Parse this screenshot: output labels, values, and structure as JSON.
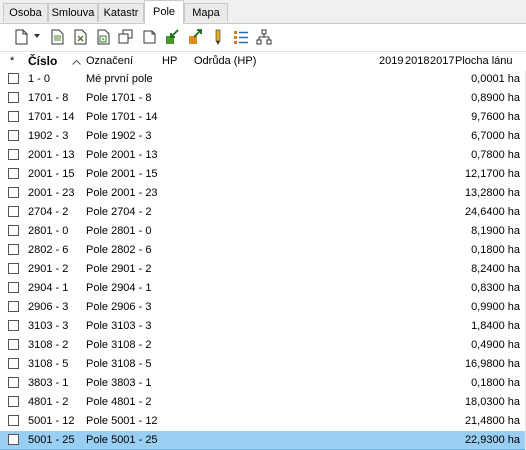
{
  "tabs": [
    {
      "label": "Osoba"
    },
    {
      "label": "Smlouva"
    },
    {
      "label": "Katastr"
    },
    {
      "label": "Pole",
      "active": true
    },
    {
      "label": "Mapa"
    }
  ],
  "toolbar": {
    "icons": [
      "new-document-icon",
      "document-icon",
      "delete-document-icon",
      "copy-document-icon",
      "copy-windows-icon",
      "window-icon",
      "import-icon",
      "export-icon",
      "pen-icon",
      "list-icon",
      "tree-icon"
    ]
  },
  "header": {
    "star": "*",
    "cislo": "Číslo",
    "oznaceni": "Označení",
    "hp": "HP",
    "odruda": "Odrůda (HP)",
    "y2019": "2019",
    "y2018": "2018",
    "y2017": "2017",
    "plocha": "Plocha lánu"
  },
  "rows": [
    {
      "cislo": "1 - 0",
      "oznaceni": "Mé první pole",
      "plocha": "0,0001 ha"
    },
    {
      "cislo": "1701 - 8",
      "oznaceni": "Pole 1701 - 8",
      "plocha": "0,8900 ha"
    },
    {
      "cislo": "1701 - 14",
      "oznaceni": "Pole 1701 - 14",
      "plocha": "9,7600 ha"
    },
    {
      "cislo": "1902 - 3",
      "oznaceni": "Pole 1902 - 3",
      "plocha": "6,7000 ha"
    },
    {
      "cislo": "2001 - 13",
      "oznaceni": "Pole 2001 - 13",
      "plocha": "0,7800 ha"
    },
    {
      "cislo": "2001 - 15",
      "oznaceni": "Pole 2001 - 15",
      "plocha": "12,1700 ha"
    },
    {
      "cislo": "2001 - 23",
      "oznaceni": "Pole 2001 - 23",
      "plocha": "13,2800 ha"
    },
    {
      "cislo": "2704 - 2",
      "oznaceni": "Pole 2704 - 2",
      "plocha": "24,6400 ha"
    },
    {
      "cislo": "2801 - 0",
      "oznaceni": "Pole 2801 - 0",
      "plocha": "8,1900 ha"
    },
    {
      "cislo": "2802 - 6",
      "oznaceni": "Pole 2802 - 6",
      "plocha": "0,1800 ha"
    },
    {
      "cislo": "2901 - 2",
      "oznaceni": "Pole 2901 - 2",
      "plocha": "8,2400 ha"
    },
    {
      "cislo": "2904 - 1",
      "oznaceni": "Pole 2904 - 1",
      "plocha": "0,8300 ha"
    },
    {
      "cislo": "2906 - 3",
      "oznaceni": "Pole 2906 - 3",
      "plocha": "0,9900 ha"
    },
    {
      "cislo": "3103 - 3",
      "oznaceni": "Pole 3103 - 3",
      "plocha": "1,8400 ha"
    },
    {
      "cislo": "3108 - 2",
      "oznaceni": "Pole 3108 - 2",
      "plocha": "0,4900 ha"
    },
    {
      "cislo": "3108 - 5",
      "oznaceni": "Pole 3108 - 5",
      "plocha": "16,9800 ha"
    },
    {
      "cislo": "3803 - 1",
      "oznaceni": "Pole 3803 - 1",
      "plocha": "0,1800 ha"
    },
    {
      "cislo": "4801 - 2",
      "oznaceni": "Pole 4801 - 2",
      "plocha": "18,0300 ha"
    },
    {
      "cislo": "5001 - 12",
      "oznaceni": "Pole 5001 - 12",
      "plocha": "21,4800 ha"
    },
    {
      "cislo": "5001 - 25",
      "oznaceni": "Pole 5001 - 25",
      "plocha": "22,9300 ha",
      "selected": true
    }
  ],
  "colors": {
    "selection": "#99cff4",
    "tab_background": "#f0f0f0"
  }
}
